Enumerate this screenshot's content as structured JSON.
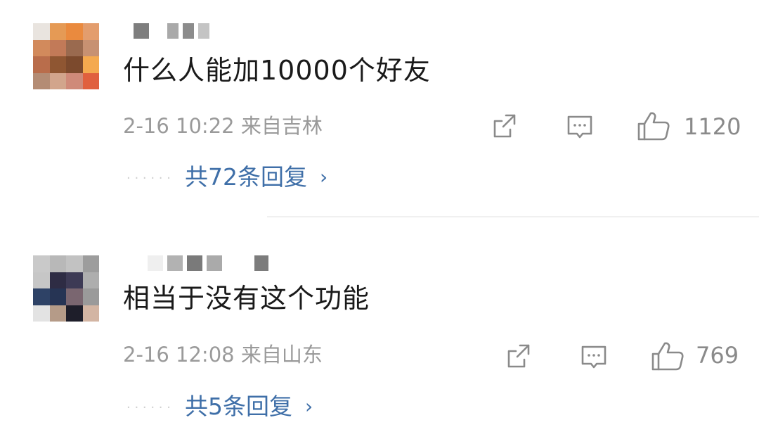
{
  "comments": [
    {
      "text": "什么人能加10000个好友",
      "time": "2-16 10:22",
      "location": "来自吉林",
      "likes": "1120",
      "replies": "共72条回复",
      "avatar_colors": [
        "#e9e4df",
        "#e59a55",
        "#ea8a3e",
        "#e39d6d",
        "#d28a5c",
        "#c27a58",
        "#9a6a4f",
        "#c79172",
        "#b96d4b",
        "#8f5632",
        "#7c4a2d",
        "#f4a94f",
        "#b48c74",
        "#d2a58c",
        "#cf8a79",
        "#e0603e"
      ],
      "name_blocks": [
        {
          "w": 22,
          "color": "#7e7e7e"
        },
        {
          "w": 14,
          "color": "#ffffff"
        },
        {
          "w": 16,
          "color": "#a9a9a9"
        },
        {
          "w": 16,
          "color": "#8c8c8c"
        },
        {
          "w": 16,
          "color": "#c4c4c4"
        }
      ]
    },
    {
      "text": "相当于没有这个功能",
      "time": "2-16 12:08",
      "location": "来自山东",
      "likes": "769",
      "replies": "共5条回复",
      "avatar_colors": [
        "#c9c9c9",
        "#b8b8b8",
        "#c2c2c2",
        "#9d9d9d",
        "#c6c6c6",
        "#2e2c44",
        "#3d3a55",
        "#aeaeae",
        "#2e4266",
        "#263454",
        "#7a6670",
        "#9a9a9a",
        "#e3e3e3",
        "#b59b88",
        "#1e1e2a",
        "#d3b5a3"
      ],
      "name_blocks": [
        {
          "w": 22,
          "color": "#efefef"
        },
        {
          "w": 22,
          "color": "#b2b2b2"
        },
        {
          "w": 22,
          "color": "#7a7a7a"
        },
        {
          "w": 22,
          "color": "#aaaaaa"
        },
        {
          "w": 34,
          "color": "#ffffff"
        },
        {
          "w": 20,
          "color": "#7c7c7c"
        }
      ]
    }
  ],
  "colors": {
    "text": "#1a1a1a",
    "meta": "#9a9a9a",
    "link": "#3f6fa8",
    "icon": "#8a8a8a"
  },
  "icons": {
    "share": "share-icon",
    "comment": "comment-icon",
    "like": "thumbs-up-icon",
    "chevron": "chevron-right-icon"
  }
}
